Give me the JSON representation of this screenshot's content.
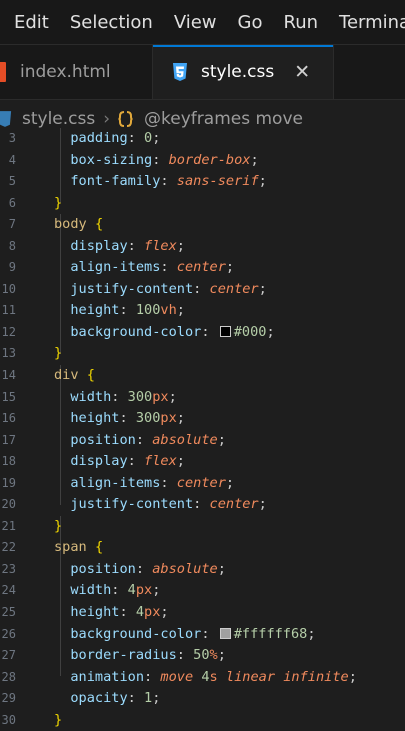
{
  "menu": [
    "Edit",
    "Selection",
    "View",
    "Go",
    "Run",
    "Terminal"
  ],
  "tabs": [
    {
      "label": "index.html",
      "active": false
    },
    {
      "label": "style.css",
      "active": true
    }
  ],
  "close_glyph": "✕",
  "breadcrumb": {
    "file": "style.css",
    "symbol": "@keyframes move"
  },
  "colors": {
    "accent": "#0078d4",
    "selector": "#d7ba7d",
    "property": "#9cdcfe",
    "value": "#f08a5d",
    "number": "#b5cea8",
    "brace": "#f1d700"
  },
  "lines": [
    {
      "n": "3",
      "tokens": [
        [
          "  ",
          "punc"
        ],
        [
          "padding",
          "prop"
        ],
        [
          ": ",
          "punc"
        ],
        [
          "0",
          "num"
        ],
        [
          ";",
          "punc"
        ]
      ]
    },
    {
      "n": "4",
      "tokens": [
        [
          "  ",
          "punc"
        ],
        [
          "box-sizing",
          "prop"
        ],
        [
          ": ",
          "punc"
        ],
        [
          "border-box",
          "val"
        ],
        [
          ";",
          "punc"
        ]
      ]
    },
    {
      "n": "5",
      "tokens": [
        [
          "  ",
          "punc"
        ],
        [
          "font-family",
          "prop"
        ],
        [
          ": ",
          "punc"
        ],
        [
          "sans-serif",
          "val"
        ],
        [
          ";",
          "punc"
        ]
      ]
    },
    {
      "n": "6",
      "tokens": [
        [
          "}",
          "brace"
        ]
      ]
    },
    {
      "n": "7",
      "tokens": [
        [
          "body",
          "sel"
        ],
        [
          " ",
          "punc"
        ],
        [
          "{",
          "brace"
        ]
      ]
    },
    {
      "n": "8",
      "tokens": [
        [
          "  ",
          "punc"
        ],
        [
          "display",
          "prop"
        ],
        [
          ": ",
          "punc"
        ],
        [
          "flex",
          "val"
        ],
        [
          ";",
          "punc"
        ]
      ]
    },
    {
      "n": "9",
      "tokens": [
        [
          "  ",
          "punc"
        ],
        [
          "align-items",
          "prop"
        ],
        [
          ": ",
          "punc"
        ],
        [
          "center",
          "val"
        ],
        [
          ";",
          "punc"
        ]
      ]
    },
    {
      "n": "10",
      "tokens": [
        [
          "  ",
          "punc"
        ],
        [
          "justify-content",
          "prop"
        ],
        [
          ": ",
          "punc"
        ],
        [
          "center",
          "val"
        ],
        [
          ";",
          "punc"
        ]
      ]
    },
    {
      "n": "11",
      "tokens": [
        [
          "  ",
          "punc"
        ],
        [
          "height",
          "prop"
        ],
        [
          ": ",
          "punc"
        ],
        [
          "100",
          "num"
        ],
        [
          "vh",
          "unit"
        ],
        [
          ";",
          "punc"
        ]
      ]
    },
    {
      "n": "12",
      "tokens": [
        [
          "  ",
          "punc"
        ],
        [
          "background-color",
          "prop"
        ],
        [
          ": ",
          "punc"
        ],
        [
          "#000",
          "num"
        ],
        [
          ";",
          "punc"
        ]
      ],
      "swatch": "#000000"
    },
    {
      "n": "13",
      "tokens": [
        [
          "}",
          "brace"
        ]
      ]
    },
    {
      "n": "14",
      "tokens": [
        [
          "div",
          "sel"
        ],
        [
          " ",
          "punc"
        ],
        [
          "{",
          "brace"
        ]
      ]
    },
    {
      "n": "15",
      "tokens": [
        [
          "  ",
          "punc"
        ],
        [
          "width",
          "prop"
        ],
        [
          ": ",
          "punc"
        ],
        [
          "300",
          "num"
        ],
        [
          "px",
          "unit"
        ],
        [
          ";",
          "punc"
        ]
      ]
    },
    {
      "n": "16",
      "tokens": [
        [
          "  ",
          "punc"
        ],
        [
          "height",
          "prop"
        ],
        [
          ": ",
          "punc"
        ],
        [
          "300",
          "num"
        ],
        [
          "px",
          "unit"
        ],
        [
          ";",
          "punc"
        ]
      ]
    },
    {
      "n": "17",
      "tokens": [
        [
          "  ",
          "punc"
        ],
        [
          "position",
          "prop"
        ],
        [
          ": ",
          "punc"
        ],
        [
          "absolute",
          "val"
        ],
        [
          ";",
          "punc"
        ]
      ]
    },
    {
      "n": "18",
      "tokens": [
        [
          "  ",
          "punc"
        ],
        [
          "display",
          "prop"
        ],
        [
          ": ",
          "punc"
        ],
        [
          "flex",
          "val"
        ],
        [
          ";",
          "punc"
        ]
      ]
    },
    {
      "n": "19",
      "tokens": [
        [
          "  ",
          "punc"
        ],
        [
          "align-items",
          "prop"
        ],
        [
          ": ",
          "punc"
        ],
        [
          "center",
          "val"
        ],
        [
          ";",
          "punc"
        ]
      ]
    },
    {
      "n": "20",
      "tokens": [
        [
          "  ",
          "punc"
        ],
        [
          "justify-content",
          "prop"
        ],
        [
          ": ",
          "punc"
        ],
        [
          "center",
          "val"
        ],
        [
          ";",
          "punc"
        ]
      ]
    },
    {
      "n": "21",
      "tokens": [
        [
          "}",
          "brace"
        ]
      ]
    },
    {
      "n": "22",
      "tokens": [
        [
          "span",
          "sel"
        ],
        [
          " ",
          "punc"
        ],
        [
          "{",
          "brace"
        ]
      ]
    },
    {
      "n": "23",
      "tokens": [
        [
          "  ",
          "punc"
        ],
        [
          "position",
          "prop"
        ],
        [
          ": ",
          "punc"
        ],
        [
          "absolute",
          "val"
        ],
        [
          ";",
          "punc"
        ]
      ]
    },
    {
      "n": "24",
      "tokens": [
        [
          "  ",
          "punc"
        ],
        [
          "width",
          "prop"
        ],
        [
          ": ",
          "punc"
        ],
        [
          "4",
          "num"
        ],
        [
          "px",
          "unit"
        ],
        [
          ";",
          "punc"
        ]
      ]
    },
    {
      "n": "25",
      "tokens": [
        [
          "  ",
          "punc"
        ],
        [
          "height",
          "prop"
        ],
        [
          ": ",
          "punc"
        ],
        [
          "4",
          "num"
        ],
        [
          "px",
          "unit"
        ],
        [
          ";",
          "punc"
        ]
      ]
    },
    {
      "n": "26",
      "tokens": [
        [
          "  ",
          "punc"
        ],
        [
          "background-color",
          "prop"
        ],
        [
          ": ",
          "punc"
        ],
        [
          "#ffffff68",
          "num"
        ],
        [
          ";",
          "punc"
        ]
      ],
      "swatch": "#a0a0a0"
    },
    {
      "n": "27",
      "tokens": [
        [
          "  ",
          "punc"
        ],
        [
          "border-radius",
          "prop"
        ],
        [
          ": ",
          "punc"
        ],
        [
          "50",
          "num"
        ],
        [
          "%",
          "unit"
        ],
        [
          ";",
          "punc"
        ]
      ]
    },
    {
      "n": "28",
      "tokens": [
        [
          "  ",
          "punc"
        ],
        [
          "animation",
          "prop"
        ],
        [
          ": ",
          "punc"
        ],
        [
          "move",
          "val"
        ],
        [
          " ",
          "punc"
        ],
        [
          "4",
          "num"
        ],
        [
          "s",
          "unit"
        ],
        [
          " ",
          "punc"
        ],
        [
          "linear",
          "val"
        ],
        [
          " ",
          "punc"
        ],
        [
          "infinite",
          "val"
        ],
        [
          ";",
          "punc"
        ]
      ]
    },
    {
      "n": "29",
      "tokens": [
        [
          "  ",
          "punc"
        ],
        [
          "opacity",
          "prop"
        ],
        [
          ": ",
          "punc"
        ],
        [
          "1",
          "num"
        ],
        [
          ";",
          "punc"
        ]
      ]
    },
    {
      "n": "30",
      "tokens": [
        [
          "}",
          "brace"
        ]
      ]
    }
  ]
}
